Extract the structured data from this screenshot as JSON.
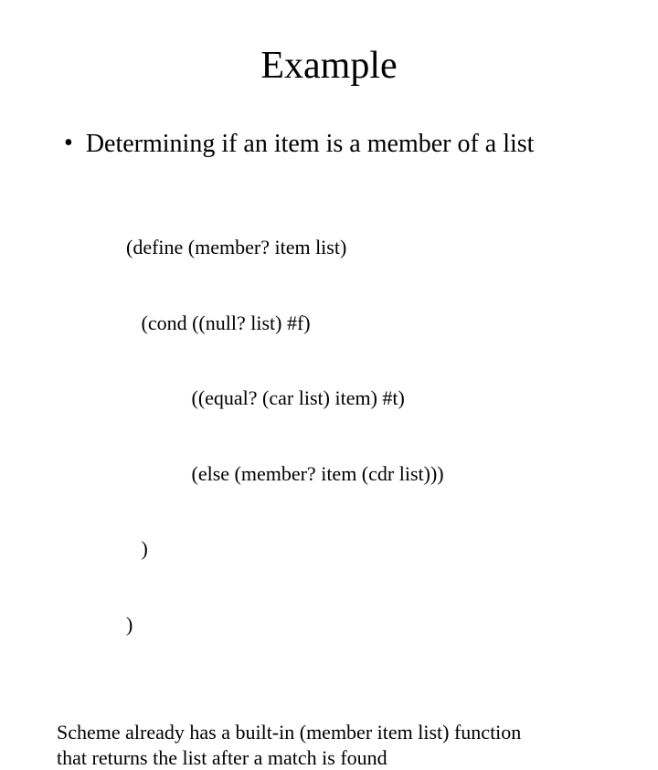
{
  "title": "Example",
  "bullet": {
    "marker": "•",
    "text": "Determining if an item is a member of a list"
  },
  "code": {
    "l1": "(define (member? item list)",
    "l2": "   (cond ((null? list) #f)",
    "l3": "             ((equal? (car list) item) #t)",
    "l4": "             (else (member? item (cdr list)))",
    "l5": "   )",
    "l6": ")"
  },
  "footnote": {
    "l1": "Scheme already has a built-in (member item list) function",
    "l2": "that returns the list after a match is found"
  }
}
